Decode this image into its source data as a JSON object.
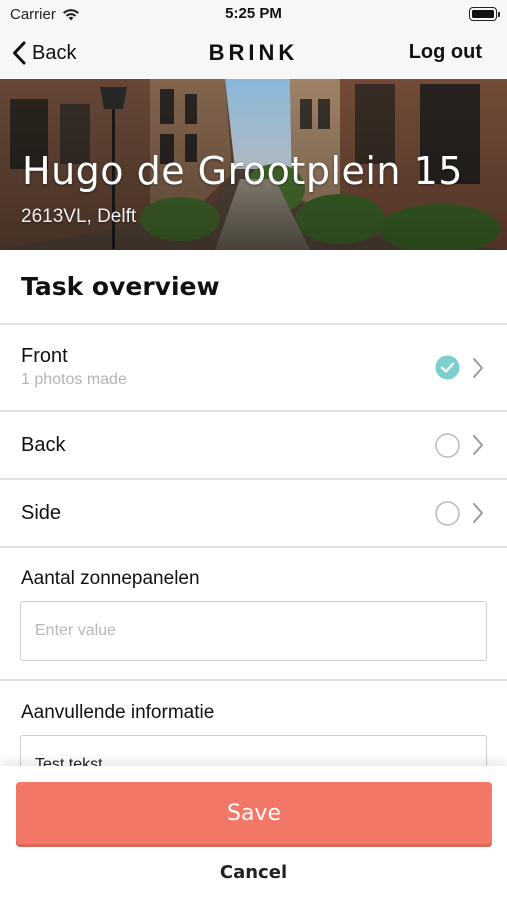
{
  "status_bar": {
    "carrier": "Carrier",
    "time": "5:25 PM",
    "wifi_icon": "wifi-icon",
    "battery_icon": "battery-icon"
  },
  "nav": {
    "back_label": "Back",
    "brand": "BRINK",
    "logout_label": "Log out",
    "back_icon": "chevron-left-icon"
  },
  "hero": {
    "title": "Hugo de Grootplein 15",
    "subtitle": "2613VL, Delft",
    "image": "street-photo"
  },
  "task_overview": {
    "title": "Task overview",
    "tasks": [
      {
        "label": "Front",
        "sub": "1 photos made",
        "completed": true
      },
      {
        "label": "Back",
        "sub": "",
        "completed": false
      },
      {
        "label": "Side",
        "sub": "",
        "completed": false
      }
    ]
  },
  "fields": [
    {
      "label": "Aantal zonnepanelen",
      "value": "",
      "placeholder": "Enter value"
    },
    {
      "label": "Aanvullende informatie",
      "value": "Test tekst",
      "placeholder": ""
    }
  ],
  "actions": {
    "save_label": "Save",
    "cancel_label": "Cancel"
  },
  "colors": {
    "accent_save": "#f27766",
    "check_teal": "#7ccfcd",
    "divider": "#e1e1e1"
  }
}
